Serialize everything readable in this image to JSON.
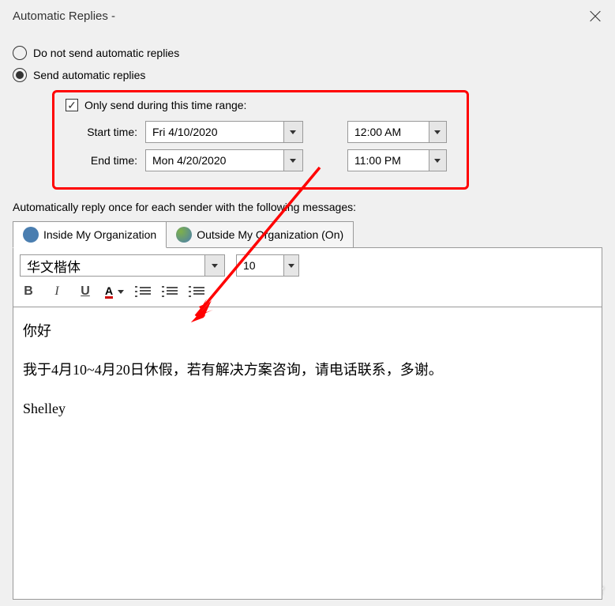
{
  "window": {
    "title": "Automatic Replies -"
  },
  "options": {
    "do_not_send": "Do not send automatic replies",
    "send": "Send automatic replies"
  },
  "time_range": {
    "only_send_label": "Only send during this time range:",
    "start_label": "Start time:",
    "end_label": "End time:",
    "start_date": "Fri 4/10/2020",
    "start_time": "12:00 AM",
    "end_date": "Mon 4/20/2020",
    "end_time": "11:00 PM"
  },
  "reply_label": "Automatically reply once for each sender with the following messages:",
  "tabs": {
    "inside": "Inside My Organization",
    "outside": "Outside My Organization (On)"
  },
  "editor": {
    "font": "华文楷体",
    "size": "10",
    "body_line1": "你好",
    "body_line2": "我于4月10~4月20日休假，若有解决方案咨询，请电话联系，多谢。",
    "body_line3": "Shelley"
  },
  "watermark": "@51CTO博客"
}
